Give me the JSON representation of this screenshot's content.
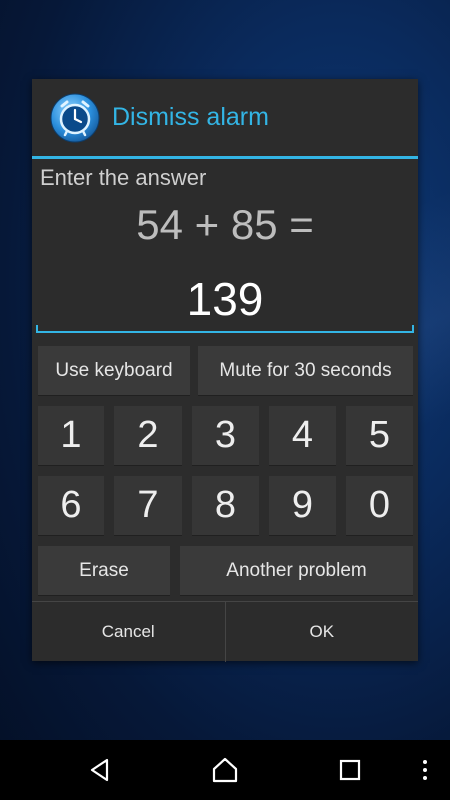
{
  "dialog": {
    "title": "Dismiss alarm",
    "icon": "alarm-clock-icon",
    "prompt": "Enter the answer",
    "problem": "54 + 85 =",
    "answer": "139"
  },
  "actions": {
    "use_keyboard": "Use keyboard",
    "mute": "Mute for 30 seconds",
    "erase": "Erase",
    "another_problem": "Another problem"
  },
  "keypad": {
    "digits": [
      "1",
      "2",
      "3",
      "4",
      "5",
      "6",
      "7",
      "8",
      "9",
      "0"
    ]
  },
  "footer": {
    "cancel": "Cancel",
    "ok": "OK"
  },
  "navbar": {
    "icons": [
      "back-icon",
      "home-icon",
      "recents-icon",
      "more-icon"
    ]
  },
  "colors": {
    "accent": "#33b5e5",
    "dialog_bg": "#2c2c2c",
    "button_bg": "#3a3a3a"
  }
}
